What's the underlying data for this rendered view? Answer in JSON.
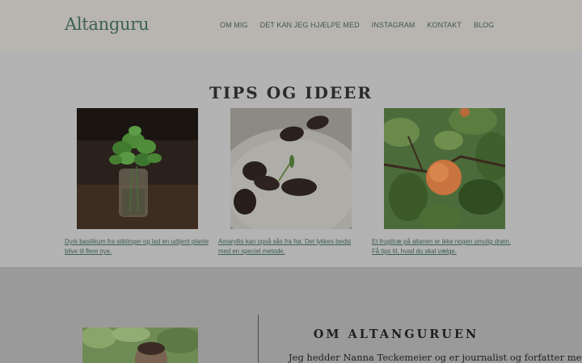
{
  "header": {
    "logo": "Altanguru",
    "nav": [
      "OM MIG",
      "DET KAN JEG HJÆLPE MED",
      "INSTAGRAM",
      "KONTAKT",
      "BLOG"
    ]
  },
  "tips": {
    "title": "TIPS OG IDEER",
    "cards": [
      {
        "image": "basil-cuttings-in-glass-jar",
        "text": "Dyrk basilikum fra stiklinger og lad en udtjent plante blive til flere nye."
      },
      {
        "image": "amaryllis-seeds-in-water",
        "text": "Amaryllis kan også sås fra frø. Det lykkes bedst med en speciel metode."
      },
      {
        "image": "apricot-on-branch",
        "text": "Et frugttræ på altanen er ikke nogen umulig drøm. Få tips til, hvad du skal vælge."
      }
    ]
  },
  "about": {
    "title": "OM ALTANGURUEN",
    "body": "Jeg hedder Nanna Teckemeier og er journalist og forfatter med",
    "portrait": "portrait-photo"
  },
  "colors": {
    "accent": "#3c6155",
    "header_bg": "#b8b4b0",
    "overlay": "#9b9b9b"
  }
}
